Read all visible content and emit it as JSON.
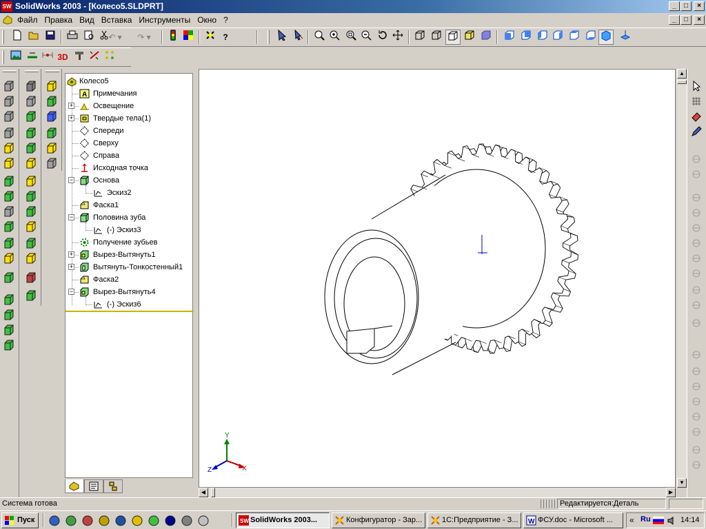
{
  "window": {
    "title": "SolidWorks 2003 - [Колесо5.SLDPRT]",
    "logo_text": "SW",
    "controls": [
      "_",
      "□",
      "×"
    ]
  },
  "menu": {
    "items": [
      "Файл",
      "Правка",
      "Вид",
      "Вставка",
      "Инструменты",
      "Окно",
      "?"
    ]
  },
  "toolbar": {
    "standard": [
      "new-icon",
      "open-icon",
      "save-icon",
      "print-icon",
      "print-preview-icon",
      "cut-icon",
      "undo-icon",
      "redo-icon",
      "traffic-light-icon",
      "color-palette-icon",
      "help-icon"
    ],
    "view": [
      "select-icon",
      "select-filter-icon",
      "zoom-fit-icon",
      "zoom-in-icon",
      "zoom-area-icon",
      "zoom-out-icon",
      "rotate-icon",
      "pan-icon"
    ],
    "display": [
      "wireframe-icon",
      "hidden-lines-visible-icon",
      "hidden-lines-removed-icon",
      "shaded-edges-icon",
      "shaded-icon"
    ],
    "orientation": [
      "view-front-icon",
      "view-back-icon",
      "view-left-icon",
      "view-right-icon",
      "view-top-icon",
      "view-bottom-icon",
      "view-isometric-icon",
      "view-normal-icon"
    ],
    "second": [
      "image-icon",
      "sketch-icon",
      "dimension-icon",
      "3d-text-icon",
      "hammer-icon",
      "measure-icon",
      "grid-icon"
    ],
    "text_3d": "3D"
  },
  "tree": {
    "root": "Колесо5",
    "items": [
      {
        "label": "Примечания",
        "icon": "annotations-icon",
        "expandable": false,
        "indent": 0
      },
      {
        "label": "Освещение",
        "icon": "lighting-icon",
        "expandable": true,
        "indent": 0
      },
      {
        "label": "Твердые тела(1)",
        "icon": "solid-bodies-icon",
        "expandable": true,
        "indent": 0
      },
      {
        "label": "Спереди",
        "icon": "plane-icon",
        "expandable": false,
        "indent": 0
      },
      {
        "label": "Сверху",
        "icon": "plane-icon",
        "expandable": false,
        "indent": 0
      },
      {
        "label": "Справа",
        "icon": "plane-icon",
        "expandable": false,
        "indent": 0
      },
      {
        "label": "Исходная точка",
        "icon": "origin-icon",
        "expandable": false,
        "indent": 0
      },
      {
        "label": "Основа",
        "icon": "extrude-icon",
        "expandable": true,
        "expanded": true,
        "indent": 0
      },
      {
        "label": "Эскиз2",
        "icon": "sketch-icon",
        "expandable": false,
        "indent": 1
      },
      {
        "label": "Фаска1",
        "icon": "chamfer-icon",
        "expandable": false,
        "indent": 0
      },
      {
        "label": "Половина зуба",
        "icon": "extrude-icon",
        "expandable": true,
        "expanded": true,
        "indent": 0
      },
      {
        "label": "(-) Эскиз3",
        "icon": "sketch-icon",
        "expandable": false,
        "indent": 1
      },
      {
        "label": "Получение зубьев",
        "icon": "pattern-icon",
        "expandable": false,
        "indent": 0
      },
      {
        "label": "Вырез-Вытянуть1",
        "icon": "cut-extrude-icon",
        "expandable": true,
        "indent": 0
      },
      {
        "label": "Вытянуть-Тонкостенный1",
        "icon": "thin-extrude-icon",
        "expandable": true,
        "indent": 0
      },
      {
        "label": "Фаска2",
        "icon": "chamfer-icon",
        "expandable": false,
        "indent": 0
      },
      {
        "label": "Вырез-Вытянуть4",
        "icon": "cut-extrude-icon",
        "expandable": true,
        "expanded": true,
        "indent": 0
      },
      {
        "label": "(-) Эскиз6",
        "icon": "sketch-icon",
        "expandable": false,
        "indent": 1
      }
    ]
  },
  "tabs": [
    "feature-manager-icon",
    "property-manager-icon",
    "configuration-manager-icon"
  ],
  "triad": {
    "x": "X",
    "y": "Y",
    "z": "Z"
  },
  "status": {
    "left": "Система готова",
    "right": "Редактируется:Деталь"
  },
  "taskbar": {
    "start": "Пуск",
    "buttons": [
      {
        "label": "SolidWorks 2003...",
        "active": true
      },
      {
        "label": "Конфигуратор - Зар...",
        "active": false
      },
      {
        "label": "1С:Предприятие - З...",
        "active": false
      },
      {
        "label": "ФСУ.doc - Microsoft ...",
        "active": false
      }
    ],
    "tray_arrows": "«",
    "lang": "Ru",
    "clock": "14:14"
  },
  "colors": {
    "titlebar": "#0a246a",
    "tree_selected_line": "#c8b400",
    "axis_x": "#c00000",
    "axis_y": "#008000",
    "axis_z": "#0000c0"
  }
}
